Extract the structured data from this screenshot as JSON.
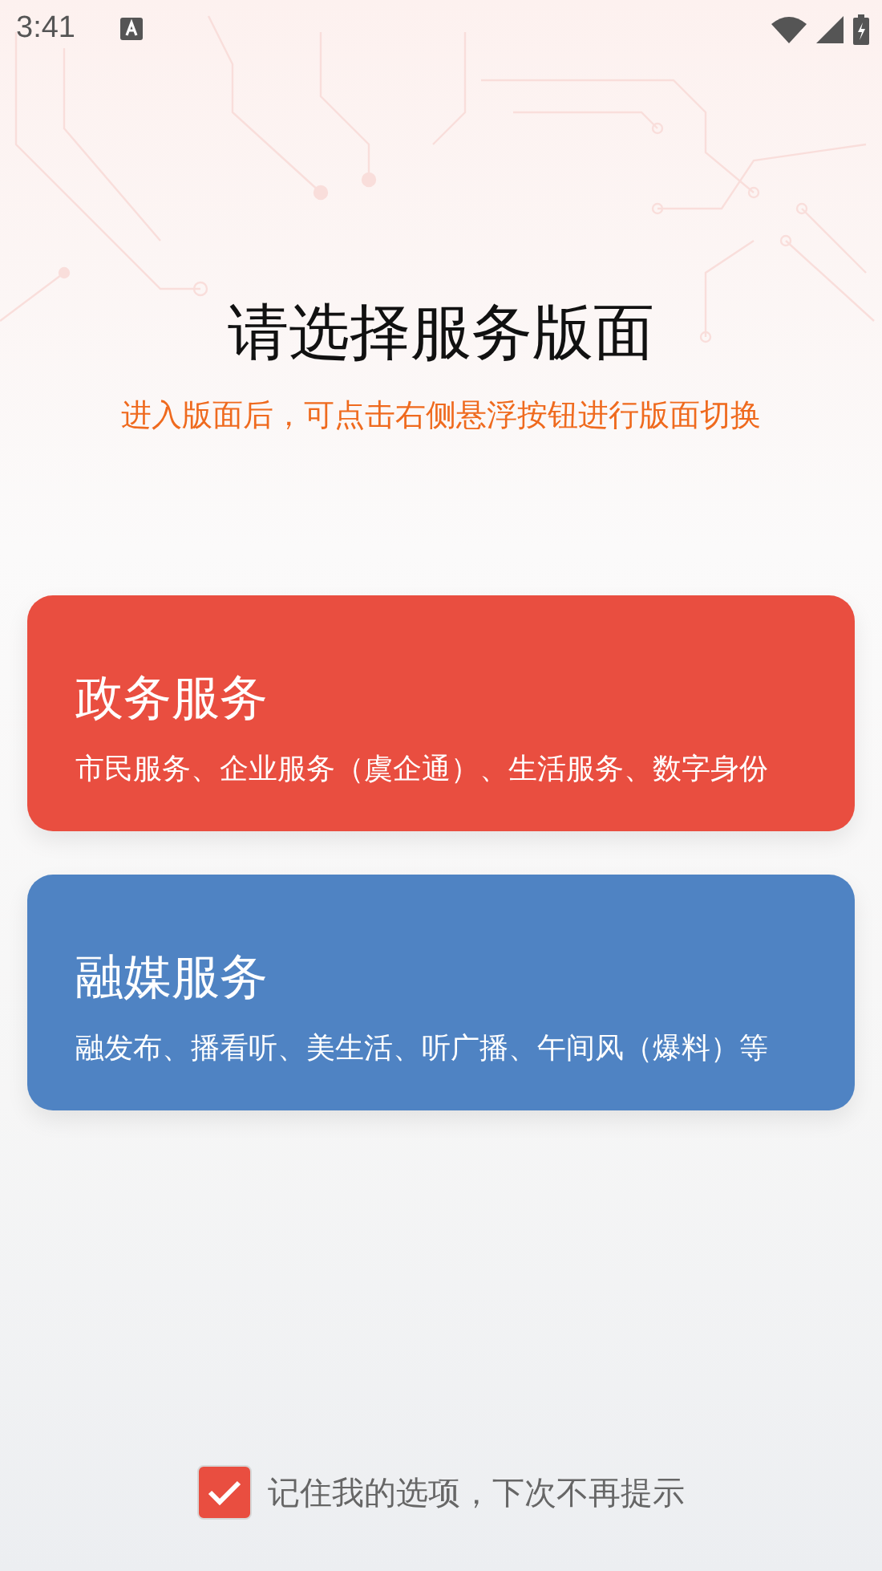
{
  "status_bar": {
    "time": "3:41"
  },
  "heading": {
    "title": "请选择服务版面",
    "subtitle": "进入版面后，可点击右侧悬浮按钮进行版面切换"
  },
  "cards": [
    {
      "title": "政务服务",
      "description": "市民服务、企业服务（虞企通）、生活服务、数字身份",
      "color": "#e94e40"
    },
    {
      "title": "融媒服务",
      "description": "融发布、播看听、美生活、听广播、午间风（爆料）等",
      "color": "#4f83c3"
    }
  ],
  "remember": {
    "label": "记住我的选项，下次不再提示",
    "checked": true
  }
}
